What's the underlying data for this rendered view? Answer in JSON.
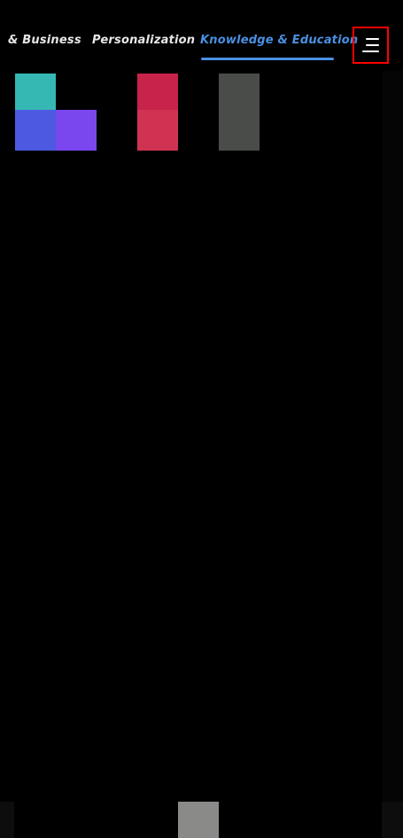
{
  "tabs": [
    {
      "label": "& Business",
      "active": false
    },
    {
      "label": "Personalization",
      "active": false
    },
    {
      "label": "Knowledge & Education",
      "active": true
    }
  ],
  "menu": {
    "icon": "hamburger-menu-icon",
    "highlight_color": "#ff0000"
  },
  "colors": {
    "background": "#000000",
    "active_tab": "#4a90e2",
    "inactive_tab": "#e6e6e6"
  },
  "tiles": [
    {
      "name": "teal-tile",
      "color": "#35b8b4"
    },
    {
      "name": "blue-tile",
      "color": "#4c59e0"
    },
    {
      "name": "purple-tile",
      "color": "#7a47ee"
    },
    {
      "name": "crimson-tile",
      "color": "#c8234a"
    },
    {
      "name": "rose-tile",
      "color": "#d03352"
    },
    {
      "name": "gray-tile",
      "color": "#4a4c4a"
    }
  ],
  "bottom_nav": {
    "handle_color": "#8a8b89"
  }
}
